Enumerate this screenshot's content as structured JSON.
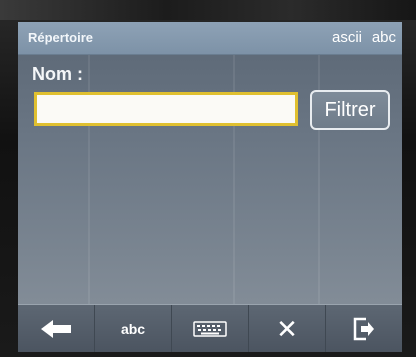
{
  "header": {
    "title": "Répertoire",
    "ascii_label": "ascii",
    "abc_label": "abc"
  },
  "form": {
    "name_label": "Nom :",
    "name_value": "",
    "filter_button_label": "Filtrer"
  },
  "toolbar": {
    "items": [
      {
        "icon": "back-arrow-icon"
      },
      {
        "icon": "abc-input-icon",
        "label": "abc"
      },
      {
        "icon": "keyboard-icon"
      },
      {
        "icon": "close-icon",
        "label": "✕"
      },
      {
        "icon": "exit-icon"
      }
    ]
  },
  "colors": {
    "titlebar": "#8ea2b6",
    "input_border": "#e0c030",
    "screen_bg": "#6a7684"
  }
}
